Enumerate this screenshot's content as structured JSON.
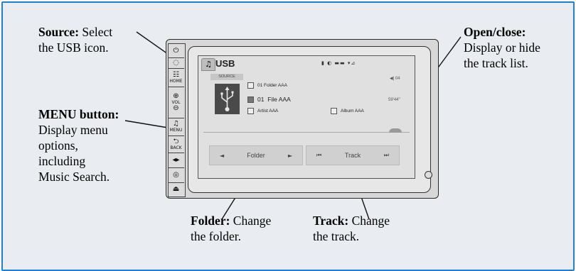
{
  "callouts": {
    "source": {
      "bold": "Source:",
      "l1": " Select",
      "l2": "the USB icon."
    },
    "menu": {
      "bold": "MENU button:",
      "l1": "Display menu",
      "l2": "options,",
      "l3": "including",
      "l4": "Music Search."
    },
    "open_close": {
      "bold": "Open/close:",
      "l1": "Display or hide",
      "l2": "the track list."
    },
    "folder": {
      "bold": "Folder:",
      "l1": " Change",
      "l2": "the folder."
    },
    "track": {
      "bold": "Track:",
      "l1": " Change",
      "l2": "the track."
    }
  },
  "side_buttons": [
    {
      "icon": "⏻",
      "label": ""
    },
    {
      "icon": "◌",
      "label": ""
    },
    {
      "icon": "☷",
      "label": "HOME"
    },
    {
      "icon": "⊕",
      "label": "VOL"
    },
    {
      "icon": "⊖",
      "label": ""
    },
    {
      "icon": "♫",
      "label": "MENU"
    },
    {
      "icon": "⮌",
      "label": "BACK"
    },
    {
      "icon": "◂▸",
      "label": ""
    },
    {
      "icon": "◎",
      "label": ""
    },
    {
      "icon": "⏏",
      "label": ""
    }
  ],
  "screen": {
    "tab_label": "USB",
    "status_icons": "▮ ◐ ▬▬ ▾⊿",
    "source_label": "SOURCE",
    "folder_row": "01 Folder AAA",
    "file_number": "01",
    "file_row": "File AAA",
    "artist_row": "Artist AAA",
    "album_row": "Album AAA",
    "volume_indicator": "◀| 04",
    "elapsed_time": "59'44\"",
    "folder_button": "Folder",
    "track_button": "Track"
  },
  "colors": {
    "frame_border": "#1f7fd0",
    "background": "#e9ecf0"
  }
}
